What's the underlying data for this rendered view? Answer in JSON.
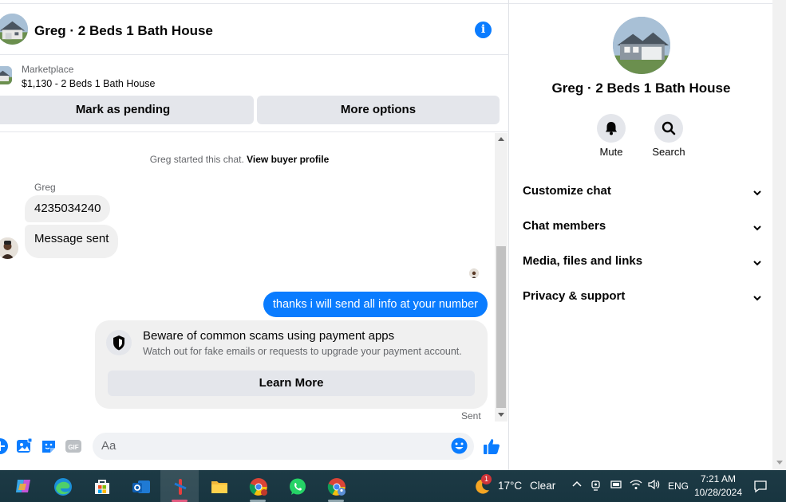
{
  "header": {
    "title": "Greg · 2 Beds 1 Bath House",
    "info_icon": "info-icon"
  },
  "listing": {
    "label": "Marketplace",
    "price_title": "$1,130 - 2 Beds 1 Bath House",
    "mark_pending": "Mark as pending",
    "more_options": "More options"
  },
  "thread": {
    "started_text": "Greg started this chat.",
    "view_profile": "View buyer profile",
    "sender": "Greg",
    "incoming": [
      "4235034240",
      "Message sent"
    ],
    "outgoing": "thanks i will send all info at your number",
    "scam_title": "Beware of common scams using payment apps",
    "scam_sub": "Watch out for fake emails or requests to upgrade your payment account.",
    "learn_more": "Learn More",
    "sent_status": "Sent"
  },
  "composer": {
    "placeholder": "Aa",
    "icons": [
      "plus-icon",
      "photo-icon",
      "sticker-icon",
      "gif-icon",
      "emoji-icon",
      "thumbs-up-icon"
    ]
  },
  "panel": {
    "title": "Greg · 2 Beds 1 Bath House",
    "mute": "Mute",
    "search": "Search",
    "sections": [
      "Customize chat",
      "Chat members",
      "Media, files and links",
      "Privacy & support"
    ]
  },
  "taskbar": {
    "apps": [
      "copilot",
      "edge",
      "microsoft-store",
      "outlook",
      "active-app",
      "file-explorer",
      "chrome",
      "whatsapp",
      "chrome-profile"
    ],
    "weather_temp": "17°C",
    "weather_desc": "Clear",
    "weather_badge": "1",
    "language": "ENG",
    "time": "7:21 AM",
    "date": "10/28/2024"
  },
  "colors": {
    "messenger_blue": "#0a7cff",
    "bubble_gray": "#f0f0f0",
    "taskbar": "#1b3943"
  }
}
